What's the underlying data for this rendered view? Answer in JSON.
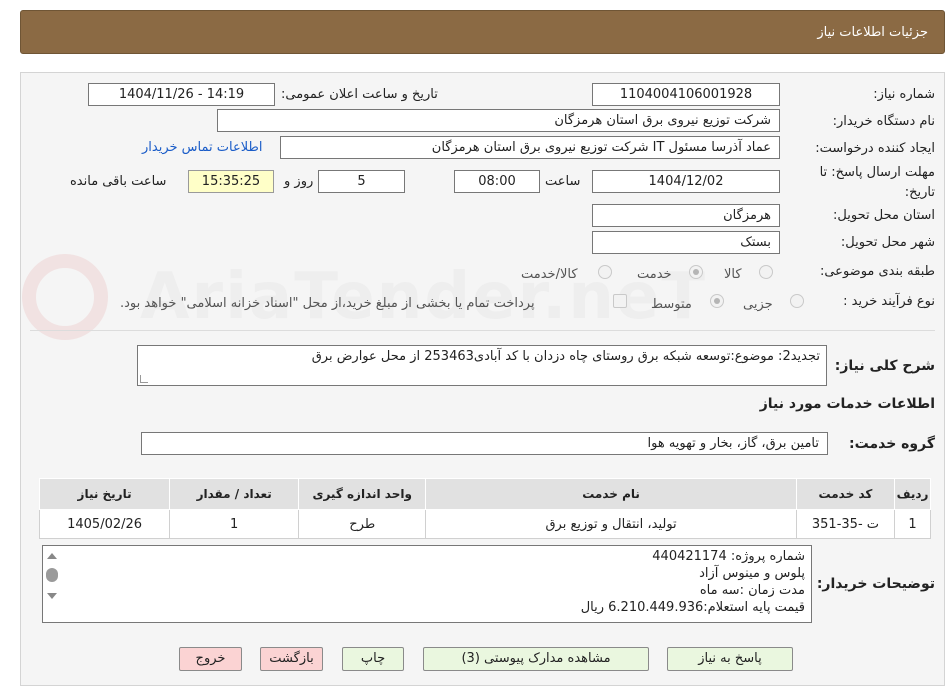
{
  "header": {
    "title": "جزئیات اطلاعات نیاز"
  },
  "form": {
    "need_number_label": "شماره نیاز:",
    "need_number": "1104004106001928",
    "announce_label": "تاریخ و ساعت اعلان عمومی:",
    "announce_value": "1404/11/26 - 14:19",
    "buyer_org_label": "نام دستگاه خریدار:",
    "buyer_org": "شرکت توزیع نیروی برق استان هرمزگان",
    "creator_label": "ایجاد کننده درخواست:",
    "creator": "عماد آذرسا مسئول IT شرکت توزیع نیروی برق استان هرمزگان",
    "contact_link": "اطلاعات تماس خریدار",
    "deadline_label": "مهلت ارسال پاسخ: تا تاریخ:",
    "deadline_date": "1404/12/02",
    "time_label": "ساعت",
    "deadline_time": "08:00",
    "days_value": "5",
    "days_label": "روز و",
    "remaining_time": "15:35:25",
    "remaining_label": "ساعت باقی مانده",
    "province_label": "استان محل تحویل:",
    "province": "هرمزگان",
    "city_label": "شهر محل تحویل:",
    "city": "بستک",
    "category_label": "طبقه بندی موضوعی:",
    "category_options": [
      "کالا",
      "خدمت",
      "کالا/خدمت"
    ],
    "category_selected": "خدمت",
    "process_label": "نوع فرآیند خرید :",
    "process_options": [
      "جزیی",
      "متوسط"
    ],
    "process_selected": "متوسط",
    "payment_note": "پرداخت تمام یا بخشی از مبلغ خرید،از محل \"اسناد خزانه اسلامی\" خواهد بود.",
    "summary_label": "شرح کلی نیاز:",
    "summary": "تجدید2: موضوع:توسعه شبکه برق روستای چاه دزدان با کد آبادی253463 از محل عوارض برق"
  },
  "services": {
    "section_title": "اطلاعات خدمات مورد نیاز",
    "group_label": "گروه خدمت:",
    "group_value": "تامین برق، گاز، بخار و تهویه هوا",
    "columns": [
      "ردیف",
      "کد خدمت",
      "نام خدمت",
      "واحد اندازه گیری",
      "تعداد / مقدار",
      "تاریخ نیاز"
    ],
    "rows": [
      [
        "1",
        "ت -35-351",
        "تولید، انتقال و توزیع برق",
        "طرح",
        "1",
        "1405/02/26"
      ]
    ]
  },
  "notes": {
    "label": "توضیحات خریدار:",
    "lines": [
      "شماره پروژه:  440421174",
      " پلوس و مینوس آزاد",
      "مدت زمان :سه ماه",
      "قیمت پایه استعلام:6.210.449.936 ریال"
    ]
  },
  "buttons": {
    "reply": "پاسخ به نیاز",
    "documents": "مشاهده مدارک پیوستی (3)",
    "print": "چاپ",
    "back": "بازگشت",
    "exit": "خروج"
  },
  "watermark": "AriaTender.neT",
  "colors": {
    "title_bar": "#8b6a44",
    "link": "#1a5cc8",
    "green_button": "#eaf7df",
    "pink_button": "#fbd3d3",
    "highlight_field": "#ffffc8"
  }
}
